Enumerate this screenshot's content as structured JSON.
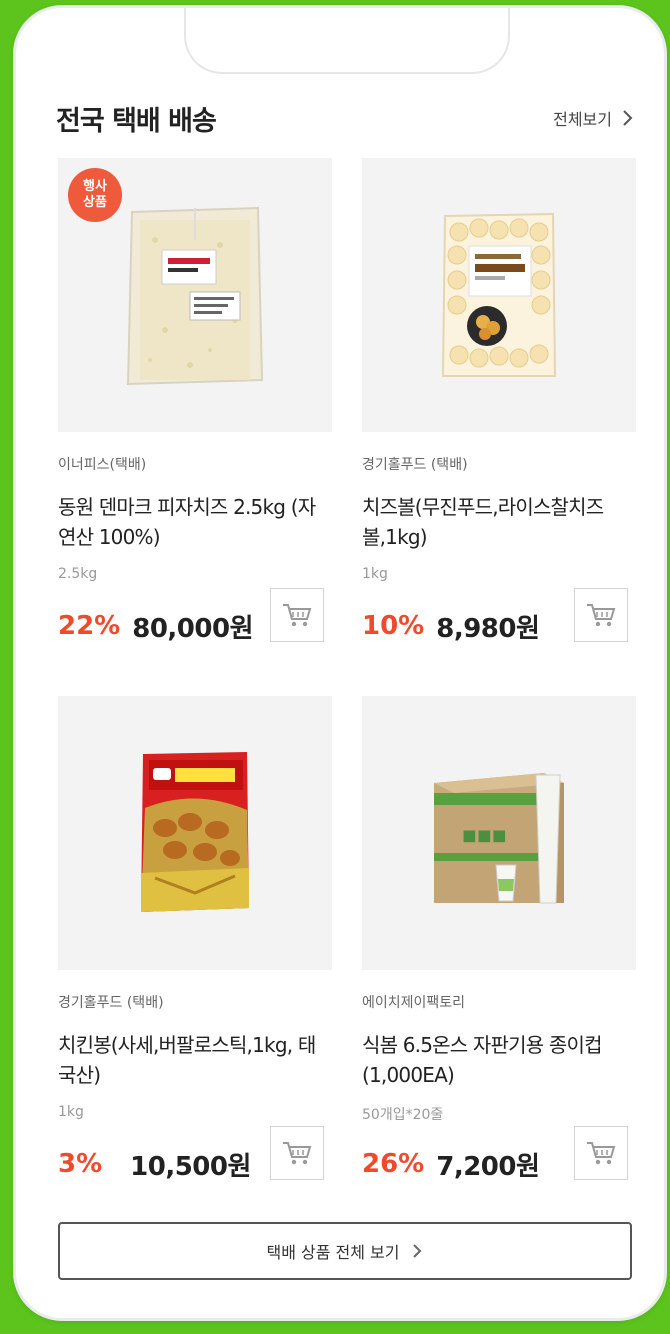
{
  "section": {
    "title": "전국 택배 배송",
    "view_all_label": "전체보기"
  },
  "products": [
    {
      "badge": [
        "행사",
        "상품"
      ],
      "seller": "이너피스(택배)",
      "name": "동원 덴마크 피자치즈 2.5kg (자연산 100%)",
      "unit": "2.5kg",
      "discount": "22%",
      "price": "80,000원",
      "image_icon": "cheese-bag-image"
    },
    {
      "seller": "경기홀푸드 (택배)",
      "name": "치즈볼(무진푸드,라이스찰치즈볼,1kg)",
      "unit": "1kg",
      "discount": "10%",
      "price": "8,980원",
      "image_icon": "cheese-ball-bag-image"
    },
    {
      "seller": "경기홀푸드 (택배)",
      "name": "치킨봉(사세,버팔로스틱,1kg, 태국산)",
      "unit": "1kg",
      "discount": "3%",
      "price": "10,500원",
      "image_icon": "chicken-stick-bag-image"
    },
    {
      "seller": "에이치제이팩토리",
      "name": "식봄 6.5온스 자판기용 종이컵 (1,000EA)",
      "unit": "50개입*20줄",
      "discount": "26%",
      "price": "7,200원",
      "image_icon": "paper-cup-box-image"
    }
  ],
  "footer": {
    "all_products_label": "택배 상품 전체 보기"
  },
  "colors": {
    "background_green": "#5cc41c",
    "discount_red": "#f04a2c",
    "badge_orange": "#f05a3c"
  }
}
